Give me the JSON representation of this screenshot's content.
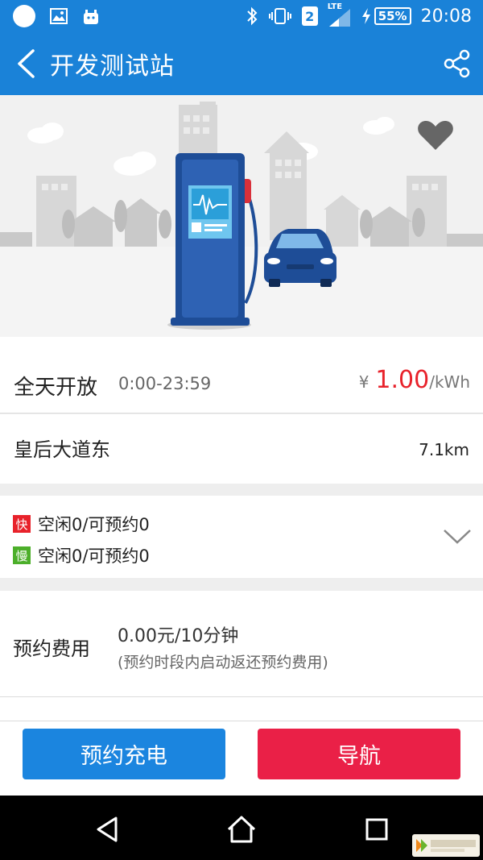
{
  "status_bar": {
    "network": "LTE",
    "sim": "2",
    "battery": "55%",
    "time": "20:08"
  },
  "header": {
    "title": "开发测试站"
  },
  "station": {
    "hours_label": "全天开放",
    "hours": "0:00-23:59",
    "price_symbol": "¥",
    "price": "1.00",
    "price_unit": "/kWh",
    "address": "皇后大道东",
    "distance": "7.1km"
  },
  "piles": [
    {
      "badge": "快",
      "badge_color": "#e8222b",
      "status": "空闲0/可预约0"
    },
    {
      "badge": "慢",
      "badge_color": "#4caf2a",
      "status": "空闲0/可预约0"
    }
  ],
  "fee": {
    "label": "预约费用",
    "value": "0.00元/10分钟",
    "note": "(预约时段内启动返还预约费用)"
  },
  "actions": {
    "reserve": "预约充电",
    "navigate": "导航"
  },
  "colors": {
    "primary": "#1a82d8",
    "accent": "#ea2047",
    "price": "#e8222b"
  },
  "watermark": {
    "brand": "快盘下载"
  }
}
